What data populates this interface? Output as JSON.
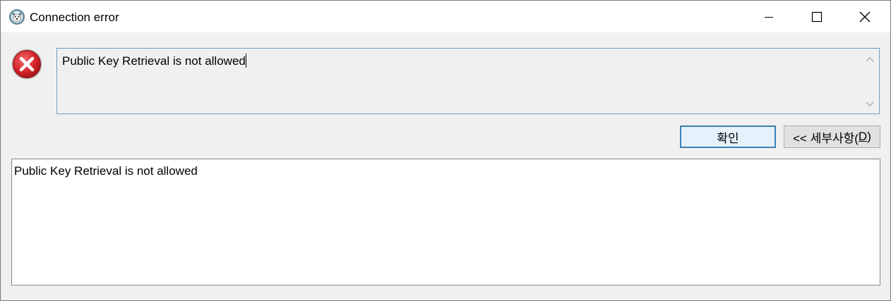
{
  "window": {
    "title": "Connection error",
    "app_icon": "dbeaver-beaver-icon",
    "controls": {
      "minimize_icon": "minimize-icon",
      "maximize_icon": "maximize-icon",
      "close_icon": "close-icon"
    }
  },
  "error": {
    "icon": "error-x-icon",
    "message": "Public Key Retrieval is not allowed"
  },
  "buttons": {
    "ok_label": "확인",
    "details_prefix": "<< 세부사항(",
    "details_mnemonic": "D",
    "details_suffix": ")"
  },
  "details": {
    "text": "Public Key Retrieval is not allowed"
  },
  "colors": {
    "error_red": "#d4252b",
    "focus_blue": "#3c7fb1",
    "dialog_bg": "#f0f0f0"
  }
}
